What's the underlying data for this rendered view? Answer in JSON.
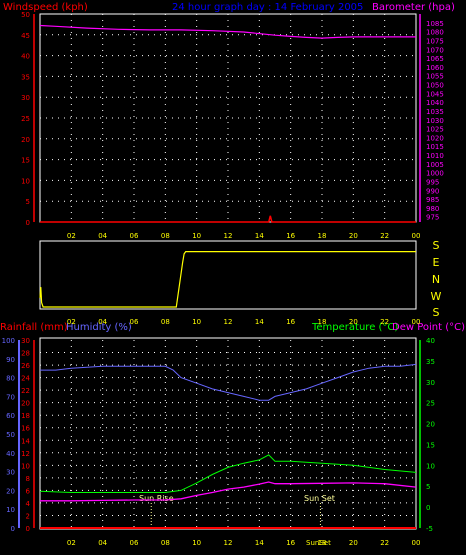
{
  "header": {
    "left_label": "Windspeed (kph)",
    "title": "24 hour graph day : 14 February 2005",
    "right_label": "Barometer (hpa)"
  },
  "colors": {
    "background": "#000000",
    "frame": "#ffffff",
    "grid": "#ffffff",
    "wind": "#ff0000",
    "barometer": "#ff00ff",
    "direction": "#ffff00",
    "rain": "#ff0000",
    "humidity": "#6666ff",
    "temperature": "#00ff00",
    "dewpoint": "#ff00ff",
    "sun": "#ffff99",
    "hour_labels": "#ffff00"
  },
  "direction_labels": [
    "S",
    "E",
    "N",
    "W",
    "S"
  ],
  "lower_labels": {
    "rainfall": "Rainfall (mm)",
    "humidity": "Humidity (%)",
    "temperature": "Temperature (°C)",
    "dewpoint": "Dew Point (°C)"
  },
  "sun_labels": {
    "sunrise": "Sun Rise",
    "sunset": "Sun Set",
    "extra": "SunSet"
  },
  "chart_data": [
    {
      "type": "line",
      "title": "24 hour graph day : 14 February 2005",
      "xlabel": "",
      "ylabel": "Windspeed (kph)",
      "x_ticks": [
        "02",
        "04",
        "06",
        "08",
        "10",
        "12",
        "14",
        "16",
        "18",
        "20",
        "22",
        "00"
      ],
      "ylim": [
        0,
        50
      ],
      "y_ticks": [
        0,
        5,
        10,
        15,
        20,
        25,
        30,
        35,
        40,
        45,
        50
      ],
      "y2label": "Barometer (hpa)",
      "y2lim": [
        972,
        1090
      ],
      "y2_ticks": [
        975,
        980,
        985,
        990,
        995,
        1000,
        1005,
        1010,
        1015,
        1020,
        1025,
        1030,
        1035,
        1040,
        1045,
        1050,
        1055,
        1060,
        1065,
        1070,
        1075,
        1080,
        1085
      ],
      "grid": true,
      "series": [
        {
          "name": "Windspeed (kph)",
          "axis": "left",
          "x": [
            0,
            4,
            8,
            12,
            14.6,
            14.7,
            14.8,
            16,
            20,
            24
          ],
          "y": [
            0,
            0,
            0,
            0,
            0,
            1.5,
            0,
            0,
            0,
            0
          ]
        },
        {
          "name": "Barometer (hpa)",
          "axis": "right",
          "x": [
            0,
            1,
            3,
            5,
            7,
            9,
            11,
            13,
            15,
            16,
            17,
            18,
            19,
            20,
            21,
            22,
            23,
            24
          ],
          "y": [
            1083.5,
            1083,
            1082,
            1081.3,
            1081,
            1081,
            1080.5,
            1079.8,
            1078,
            1077.3,
            1076.7,
            1076.3,
            1076.7,
            1077,
            1077,
            1077,
            1077,
            1077
          ]
        }
      ]
    },
    {
      "type": "line",
      "title": "",
      "xlabel": "",
      "ylabel": "Wind direction",
      "x_ticks": [
        "02",
        "04",
        "06",
        "08",
        "10",
        "12",
        "14",
        "16",
        "18",
        "20",
        "22",
        "00"
      ],
      "y_ticks": [
        "S",
        "E",
        "N",
        "W",
        "S"
      ],
      "grid": false,
      "series": [
        {
          "name": "Direction",
          "x": [
            0,
            0.05,
            0.1,
            0.2,
            8.7,
            9.1,
            9.2,
            9.3,
            24
          ],
          "y": [
            20,
            45,
            10,
            0,
            0,
            100,
            120,
            125,
            125
          ]
        }
      ]
    },
    {
      "type": "line",
      "title": "",
      "xlabel": "",
      "ylabel": "Humidity (%)",
      "x_ticks": [
        "02",
        "04",
        "06",
        "08",
        "10",
        "12",
        "14",
        "16",
        "18",
        "20",
        "22",
        "00"
      ],
      "ylim": [
        0,
        100
      ],
      "y_ticks": [
        0,
        10,
        20,
        30,
        40,
        50,
        60,
        70,
        80,
        90,
        100
      ],
      "y_rain_label": "Rainfall (mm)",
      "y_rain_lim": [
        0,
        30
      ],
      "y_rain_ticks": [
        0,
        2,
        4,
        6,
        8,
        10,
        12,
        14,
        16,
        18,
        20,
        22,
        24,
        26,
        28,
        30
      ],
      "y2label": "Temperature (°C)",
      "y2lim": [
        -5,
        40
      ],
      "y2_ticks": [
        -5,
        0,
        5,
        10,
        15,
        20,
        25,
        30,
        35,
        40
      ],
      "grid": true,
      "annotations": [
        {
          "text": "Sun Rise",
          "x": 7.1
        },
        {
          "text": "Sun Set",
          "x": 17.9
        }
      ],
      "series": [
        {
          "name": "Rainfall (mm)",
          "axis": "rain",
          "x": [
            0,
            24
          ],
          "y": [
            0,
            0
          ]
        },
        {
          "name": "Humidity (%)",
          "axis": "left",
          "x": [
            0,
            1,
            2,
            4,
            6,
            7,
            8,
            8.5,
            9,
            10,
            11,
            12,
            13,
            14,
            14.6,
            15,
            16,
            17,
            18,
            19,
            20,
            21,
            22,
            23,
            24
          ],
          "y": [
            84,
            84,
            85,
            86,
            86,
            86,
            86,
            84,
            80,
            77,
            74,
            72,
            70,
            68,
            68,
            70,
            72,
            74,
            77,
            80,
            83,
            85,
            86,
            86,
            87
          ]
        },
        {
          "name": "Temperature (°C)",
          "axis": "right",
          "x": [
            0,
            2,
            4,
            6,
            8,
            9,
            10,
            11,
            12,
            13,
            14,
            14.6,
            15,
            16,
            18,
            20,
            22,
            24
          ],
          "y": [
            3.8,
            3.5,
            3.5,
            3.5,
            3.5,
            4,
            5.8,
            7.8,
            9.5,
            10.5,
            11.3,
            12.5,
            11,
            11,
            10.5,
            10,
            9,
            8.3
          ]
        },
        {
          "name": "Dew Point (°C)",
          "axis": "right",
          "x": [
            0,
            2,
            4,
            6,
            8,
            9,
            10,
            11,
            12,
            13,
            14,
            14.6,
            15,
            16,
            18,
            20,
            22,
            24
          ],
          "y": [
            1.5,
            1.5,
            1.6,
            1.7,
            1.7,
            2,
            2.8,
            3.5,
            4.3,
            4.8,
            5.5,
            6,
            5.6,
            5.6,
            5.7,
            5.8,
            5.6,
            4.8
          ]
        }
      ]
    }
  ]
}
